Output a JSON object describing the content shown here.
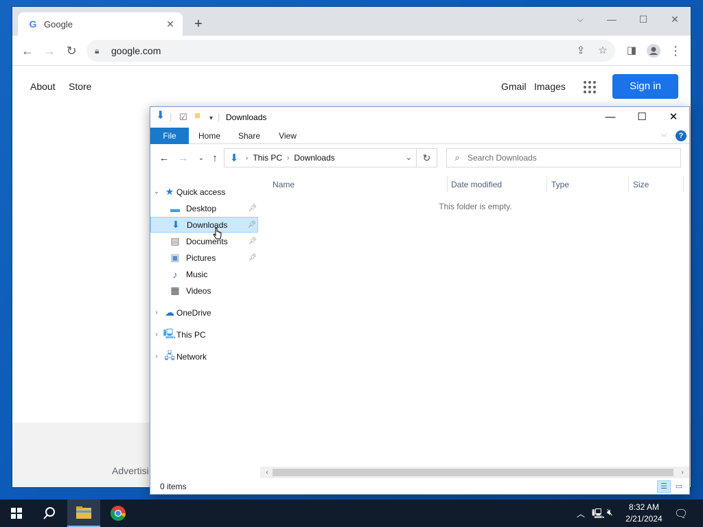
{
  "chrome": {
    "tab_title": "Google",
    "tab_favicon": "G",
    "new_tab": "+",
    "url": "google.com",
    "icons": {
      "back": "back-arrow-icon",
      "forward": "forward-arrow-icon",
      "reload": "reload-icon",
      "lock": "lock-icon",
      "share": "share-icon",
      "bookmark": "star-icon",
      "side_panel": "side-panel-icon",
      "profile": "profile-icon",
      "menu": "kebab-menu-icon"
    }
  },
  "google": {
    "nav_left": [
      "About",
      "Store"
    ],
    "nav_right": [
      "Gmail",
      "Images"
    ],
    "signin": "Sign in",
    "footer_left": "Advertisi",
    "signin_color": "#1a73e8"
  },
  "explorer": {
    "title": "Downloads",
    "ribbon_tabs": [
      "File",
      "Home",
      "Share",
      "View"
    ],
    "help": "?",
    "breadcrumb": [
      "This PC",
      "Downloads"
    ],
    "search_placeholder": "Search Downloads",
    "nav": {
      "quick_access": "Quick access",
      "items": [
        {
          "label": "Desktop",
          "icon": "desktop-folder-icon",
          "pinned": true
        },
        {
          "label": "Downloads",
          "icon": "downloads-folder-icon",
          "pinned": true,
          "selected": true
        },
        {
          "label": "Documents",
          "icon": "documents-folder-icon",
          "pinned": true
        },
        {
          "label": "Pictures",
          "icon": "pictures-folder-icon",
          "pinned": true
        },
        {
          "label": "Music",
          "icon": "music-folder-icon",
          "pinned": false
        },
        {
          "label": "Videos",
          "icon": "videos-folder-icon",
          "pinned": false
        }
      ],
      "roots": [
        "OneDrive",
        "This PC",
        "Network"
      ]
    },
    "columns": [
      "Name",
      "Date modified",
      "Type",
      "Size"
    ],
    "empty_message": "This folder is empty.",
    "status": "0 items",
    "accent": "#1979ca"
  },
  "taskbar": {
    "time": "8:32 AM",
    "date": "2/21/2024",
    "icons": [
      "start-icon",
      "search-icon",
      "file-explorer-icon",
      "chrome-icon"
    ],
    "tray": [
      "chevron-up-icon",
      "network-icon",
      "volume-muted-icon",
      "notification-icon"
    ]
  }
}
